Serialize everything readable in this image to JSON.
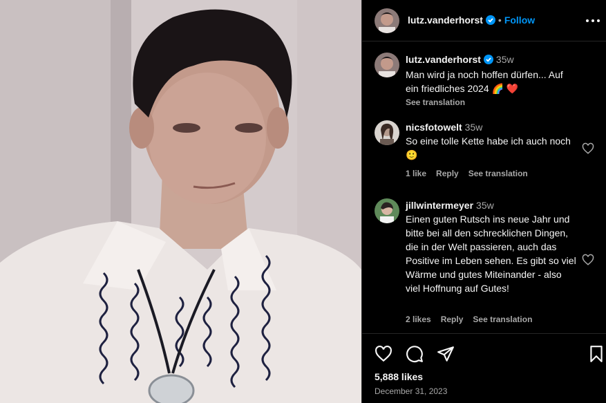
{
  "post": {
    "username": "lutz.vanderhorst",
    "follow_label": "Follow",
    "dot": "•",
    "caption": {
      "username": "lutz.vanderhorst",
      "time": "35w",
      "text": "Man wird ja noch hoffen dürfen... Auf ein friedliches 2024 🌈 ❤️",
      "see_translation": "See translation"
    },
    "likes": "5,888 likes",
    "date": "December 31, 2023"
  },
  "comments": [
    {
      "username": "nicsfotowelt",
      "time": "35w",
      "text": "So eine tolle Kette habe ich auch noch 🙂",
      "likes": "1 like",
      "reply": "Reply",
      "see_translation": "See translation"
    },
    {
      "username": "jillwintermeyer",
      "time": "35w",
      "text": "Einen guten Rutsch ins neue Jahr und bitte bei all den schrecklichen Dingen, die in der Welt passieren, auch das Positive im Leben sehen. Es gibt so viel Wärme und gutes Miteinander - also viel Hoffnung auf Gutes!",
      "likes": "2 likes",
      "reply": "Reply",
      "see_translation": "See translation"
    }
  ],
  "colors": {
    "link": "#0095f6",
    "verified": "#0095f6",
    "muted": "#a8a8a8",
    "background": "#000000"
  },
  "icons": [
    "verified-badge-icon",
    "more-options-icon",
    "heart-icon",
    "comment-icon",
    "share-icon",
    "save-bookmark-icon"
  ]
}
